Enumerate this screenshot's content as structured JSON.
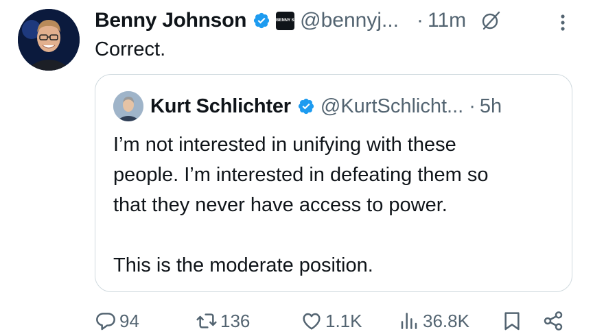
{
  "tweet": {
    "author_name": "Benny Johnson",
    "affiliate_badge_text": "BENNY SHOW",
    "handle": "@bennyj...",
    "separator": "·",
    "time": "11m",
    "text": "Correct."
  },
  "quote": {
    "author_name": "Kurt Schlichter",
    "handle": "@KurtSchlicht...",
    "separator": "·",
    "time": "5h",
    "lines": [
      "I’m not interested in unifying with these",
      "people. I’m interested in defeating them so",
      "that they never have access to power."
    ],
    "line2": "This is the moderate position."
  },
  "actions": {
    "replies": "94",
    "reposts": "136",
    "likes": "1.1K",
    "views": "36.8K"
  },
  "colors": {
    "text": "#0f1419",
    "secondary": "#536471",
    "verified": "#1d9bf0",
    "border": "#cfd9de"
  }
}
